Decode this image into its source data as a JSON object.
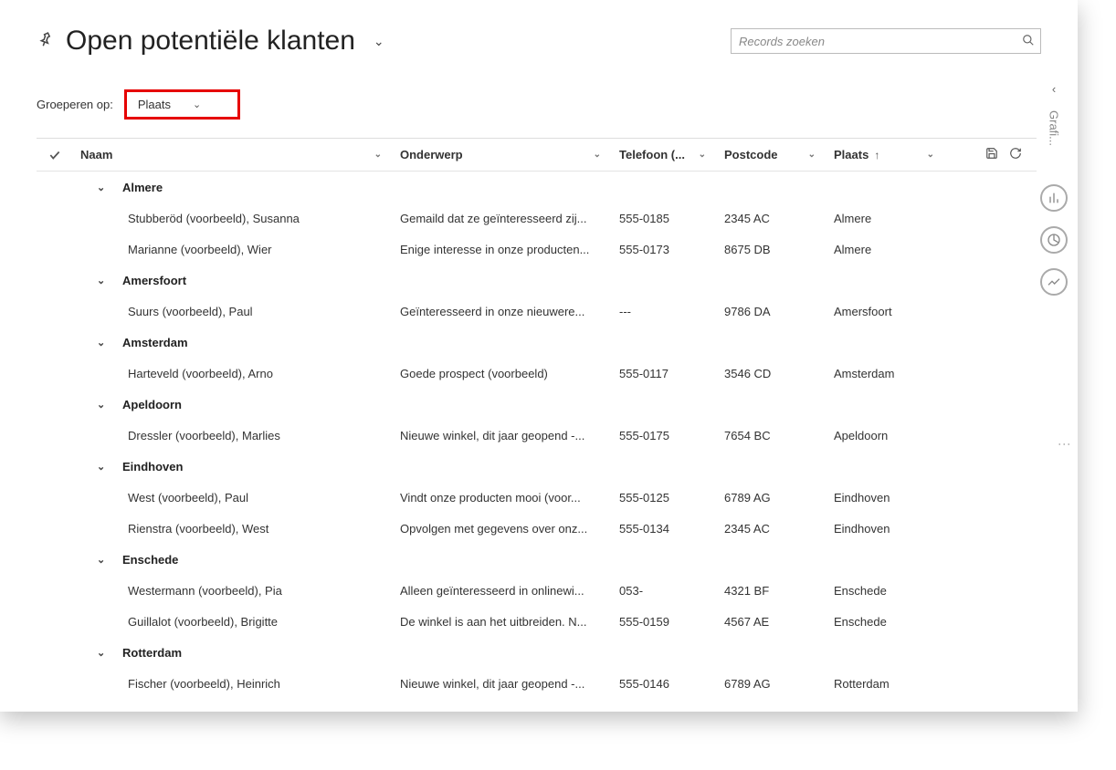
{
  "header": {
    "title": "Open potentiële klanten",
    "search_placeholder": "Records zoeken"
  },
  "grouping": {
    "label": "Groeperen op:",
    "selected": "Plaats"
  },
  "columns": {
    "naam": "Naam",
    "onderwerp": "Onderwerp",
    "telefoon": "Telefoon (...",
    "postcode": "Postcode",
    "plaats": "Plaats"
  },
  "groups": [
    {
      "name": "Almere",
      "rows": [
        {
          "naam": "Stubberöd (voorbeeld), Susanna",
          "onderwerp": "Gemaild dat ze geïnteresseerd zij...",
          "telefoon": "555-0185",
          "postcode": "2345 AC",
          "plaats": "Almere"
        },
        {
          "naam": "Marianne (voorbeeld), Wier",
          "onderwerp": "Enige interesse in onze producten...",
          "telefoon": "555-0173",
          "postcode": "8675 DB",
          "plaats": "Almere"
        }
      ]
    },
    {
      "name": "Amersfoort",
      "rows": [
        {
          "naam": "Suurs (voorbeeld), Paul",
          "onderwerp": "Geïnteresseerd in onze nieuwere...",
          "telefoon": "---",
          "postcode": "9786 DA",
          "plaats": "Amersfoort"
        }
      ]
    },
    {
      "name": "Amsterdam",
      "rows": [
        {
          "naam": "Harteveld (voorbeeld), Arno",
          "onderwerp": "Goede prospect (voorbeeld)",
          "telefoon": "555-0117",
          "postcode": "3546 CD",
          "plaats": "Amsterdam"
        }
      ]
    },
    {
      "name": "Apeldoorn",
      "rows": [
        {
          "naam": "Dressler (voorbeeld), Marlies",
          "onderwerp": "Nieuwe winkel, dit jaar geopend -...",
          "telefoon": "555-0175",
          "postcode": "7654 BC",
          "plaats": "Apeldoorn"
        }
      ]
    },
    {
      "name": "Eindhoven",
      "rows": [
        {
          "naam": "West (voorbeeld), Paul",
          "onderwerp": "Vindt onze producten mooi (voor...",
          "telefoon": "555-0125",
          "postcode": "6789 AG",
          "plaats": "Eindhoven"
        },
        {
          "naam": "Rienstra (voorbeeld), West",
          "onderwerp": "Opvolgen met gegevens over onz...",
          "telefoon": "555-0134",
          "postcode": "2345 AC",
          "plaats": "Eindhoven"
        }
      ]
    },
    {
      "name": "Enschede",
      "rows": [
        {
          "naam": "Westermann (voorbeeld), Pia",
          "onderwerp": "Alleen geïnteresseerd in onlinewi...",
          "telefoon": "053-",
          "postcode": "4321 BF",
          "plaats": "Enschede"
        },
        {
          "naam": "Guillalot (voorbeeld), Brigitte",
          "onderwerp": "De winkel is aan het uitbreiden. N...",
          "telefoon": "555-0159",
          "postcode": "4567 AE",
          "plaats": "Enschede"
        }
      ]
    },
    {
      "name": "Rotterdam",
      "rows": [
        {
          "naam": "Fischer (voorbeeld), Heinrich",
          "onderwerp": "Nieuwe winkel, dit jaar geopend -...",
          "telefoon": "555-0146",
          "postcode": "6789 AG",
          "plaats": "Rotterdam"
        }
      ]
    }
  ],
  "rail": {
    "label": "Grafi..."
  }
}
